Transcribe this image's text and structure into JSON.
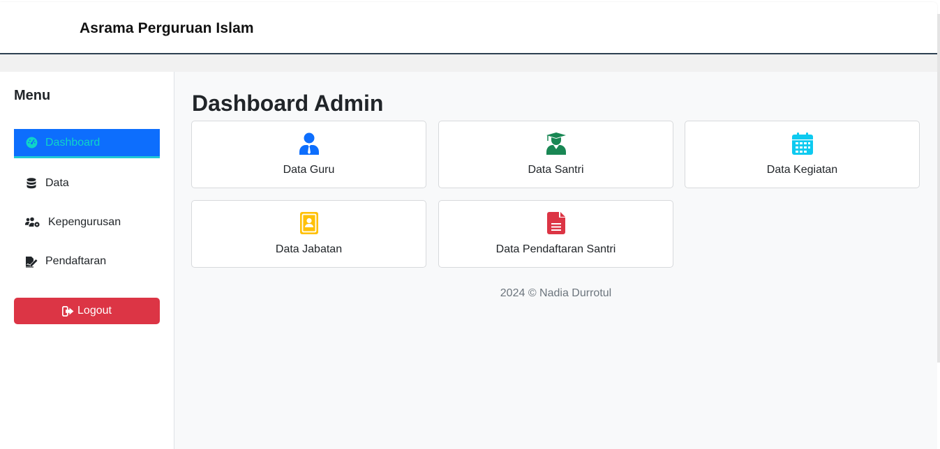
{
  "header": {
    "brand": "Asrama Perguruan Islam"
  },
  "sidebar": {
    "title": "Menu",
    "items": [
      {
        "label": "Dashboard",
        "icon": "dashboard-gauge-icon",
        "active": true
      },
      {
        "label": "Data",
        "icon": "database-icon",
        "active": false
      },
      {
        "label": "Kepengurusan",
        "icon": "users-cog-icon",
        "active": false
      },
      {
        "label": "Pendaftaran",
        "icon": "file-signature-icon",
        "active": false
      }
    ],
    "logout_label": "Logout"
  },
  "main": {
    "title": "Dashboard Admin",
    "cards": [
      {
        "label": "Data Guru",
        "icon": "user-tie-icon",
        "color": "#0d6efd"
      },
      {
        "label": "Data Santri",
        "icon": "user-graduate-icon",
        "color": "#198754"
      },
      {
        "label": "Data Kegiatan",
        "icon": "calendar-icon",
        "color": "#0dcaf0"
      },
      {
        "label": "Data Jabatan",
        "icon": "id-badge-icon",
        "color": "#ffc107"
      },
      {
        "label": "Data Pendaftaran Santri",
        "icon": "file-alt-icon",
        "color": "#dc3545"
      }
    ]
  },
  "footer": {
    "text": "2024 © Nadia Durrotul"
  },
  "colors": {
    "primary": "#0d6efd",
    "danger": "#dc3545",
    "active_text": "#0fd4c8",
    "navbar_border": "#2d4052"
  }
}
